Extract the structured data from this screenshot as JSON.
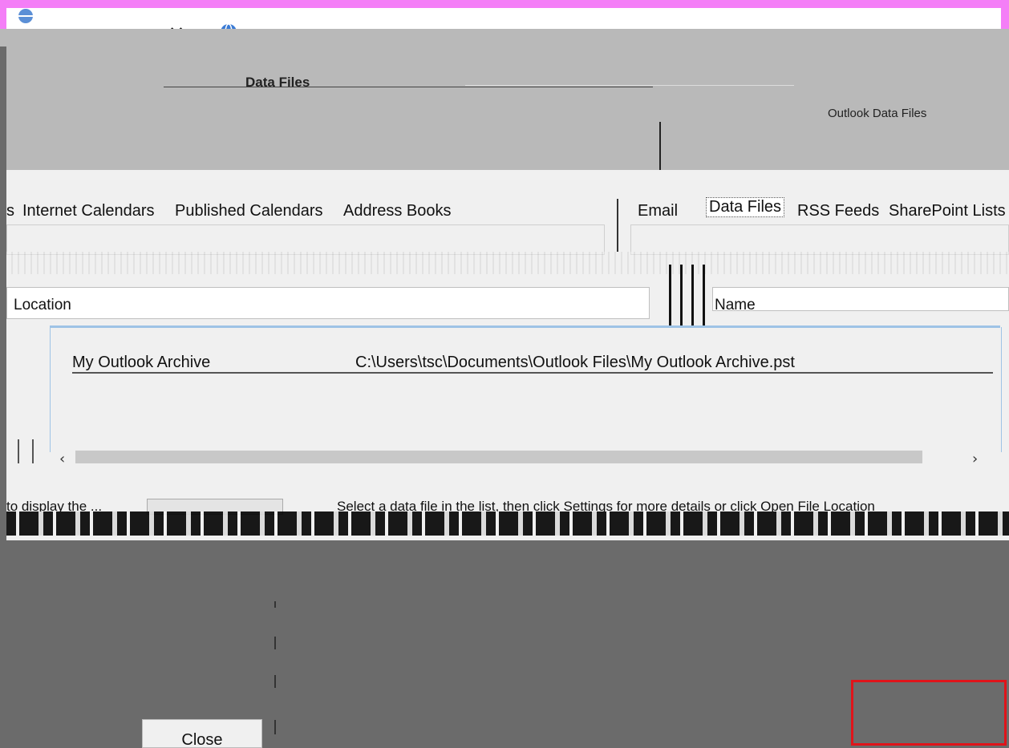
{
  "section_title": "Data Files",
  "subtitle": "Outlook Data Files",
  "tabs_left": [
    "s",
    "Internet Calendars",
    "Published Calendars",
    "Address Books"
  ],
  "tabs_right": [
    {
      "label": "Email",
      "active": false
    },
    {
      "label": "Data Files",
      "active": true
    },
    {
      "label": "RSS Feeds",
      "active": false
    },
    {
      "label": "SharePoint Lists",
      "active": false
    }
  ],
  "columns": {
    "left_header": "Location",
    "right_header": "Name"
  },
  "rows": [
    {
      "name": "My Outlook Archive",
      "location": "C:\\Users\\tsc\\Documents\\Outlook Files\\My Outlook Archive.pst"
    }
  ],
  "help_text": "Select a data file in the list, then click Settings for more details or click Open File Location",
  "left_help_text": "to display the ...",
  "close_button": {
    "label": "Close"
  },
  "colors": {
    "magenta_strip": "#f47ef7",
    "dark_gray": "#6b6b6b",
    "highlight_red": "#e0141a"
  }
}
